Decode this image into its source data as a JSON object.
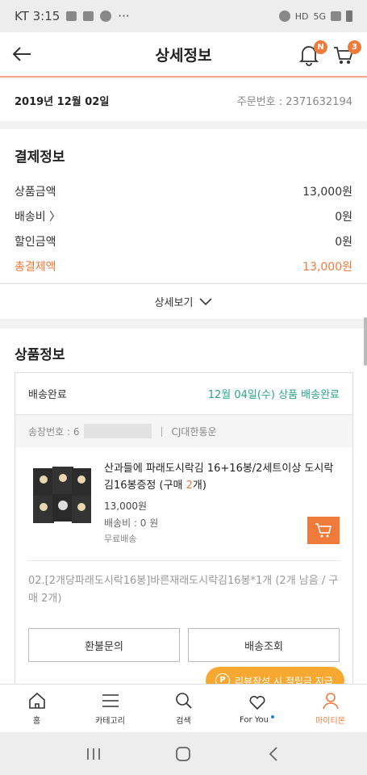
{
  "status_bar": {
    "carrier_time": "KT 3:15",
    "dots": "···",
    "hd": "HD",
    "network": "5G"
  },
  "header": {
    "title": "상세정보",
    "notification_badge": "N",
    "cart_badge": "3"
  },
  "order": {
    "date": "2019년 12월 02일",
    "order_number": "주문번호 : 2371632194"
  },
  "payment": {
    "title": "결제정보",
    "rows": [
      {
        "label": "상품금액",
        "value": "13,000원"
      },
      {
        "label": "배송비 〉",
        "value": "0원"
      },
      {
        "label": "할인금액",
        "value": "0원"
      },
      {
        "label": "총결제액",
        "value": "13,000원"
      }
    ],
    "detail_toggle": "상세보기"
  },
  "product_section": {
    "title": "상품정보",
    "delivery_status": "배송완료",
    "delivery_info": "12월 04일(수) 상품 배송완료",
    "tracking_label": "송장번호 : 6",
    "carrier": "CJ대한통운",
    "product_name": "산과들에 파래도시락김 16+16봉/2세트이상 도시락김16봉증정 (구매 ",
    "product_qty": "2",
    "product_name_end": "개)",
    "price": "13,000원",
    "shipping_fee": "배송비 : 0 원",
    "free_shipping": "무료배송",
    "option": "02.[2개당파래도시락16봉]바른재래도시락김16봉*1개 (2개 남음 / 구매 2개)",
    "refund_button": "환불문의",
    "tracking_button": "배송조회",
    "review_banner": "리뷰작성 시 적립금 지급",
    "review_icon_letter": "P"
  },
  "bottom_nav": [
    {
      "label": "홈",
      "icon": "home-icon"
    },
    {
      "label": "카테고리",
      "icon": "menu-icon"
    },
    {
      "label": "검색",
      "icon": "search-icon"
    },
    {
      "label": "For You",
      "icon": "heart-icon"
    },
    {
      "label": "마이티몬",
      "icon": "user-icon"
    }
  ],
  "accent_color": "#f07a3a",
  "delivery_color": "#2aa58a"
}
